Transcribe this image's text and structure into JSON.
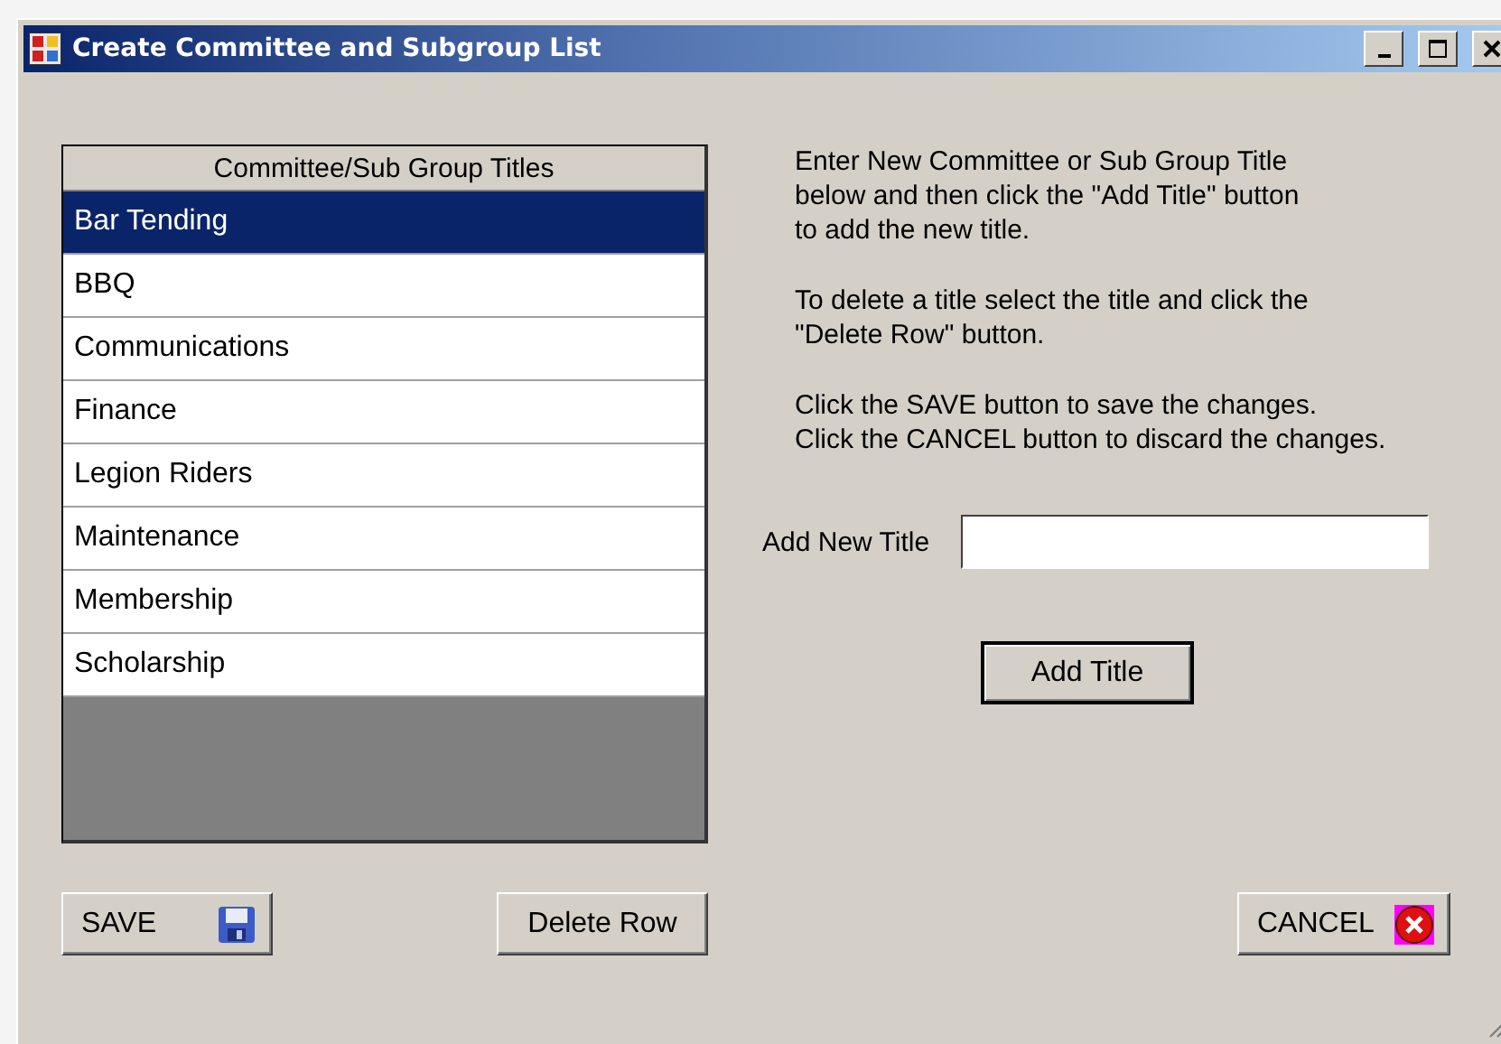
{
  "window": {
    "title": "Create Committee and Subgroup List"
  },
  "grid": {
    "header": "Committee/Sub Group Titles",
    "rows": [
      {
        "label": "Bar Tending",
        "selected": true
      },
      {
        "label": "BBQ",
        "selected": false
      },
      {
        "label": "Communications",
        "selected": false
      },
      {
        "label": "Finance",
        "selected": false
      },
      {
        "label": "Legion Riders",
        "selected": false
      },
      {
        "label": "Maintenance",
        "selected": false
      },
      {
        "label": "Membership",
        "selected": false
      },
      {
        "label": "Scholarship",
        "selected": false
      }
    ]
  },
  "instructions": [
    "Enter New Committee or Sub Group Title\nbelow and then click the \"Add Title\" button\nto add the new title.",
    "To delete a title select the title and click the\n\"Delete Row\" button.",
    "Click the SAVE button to save the changes.\nClick the CANCEL button to discard the changes."
  ],
  "add_title_field": {
    "label": "Add New Title"
  },
  "add_button": "Add Title",
  "buttons": [
    {
      "kind": "save",
      "label": "SAVE"
    },
    {
      "kind": "delete",
      "label": "Delete Row"
    },
    {
      "kind": "cancel",
      "label": "CANCEL"
    }
  ]
}
